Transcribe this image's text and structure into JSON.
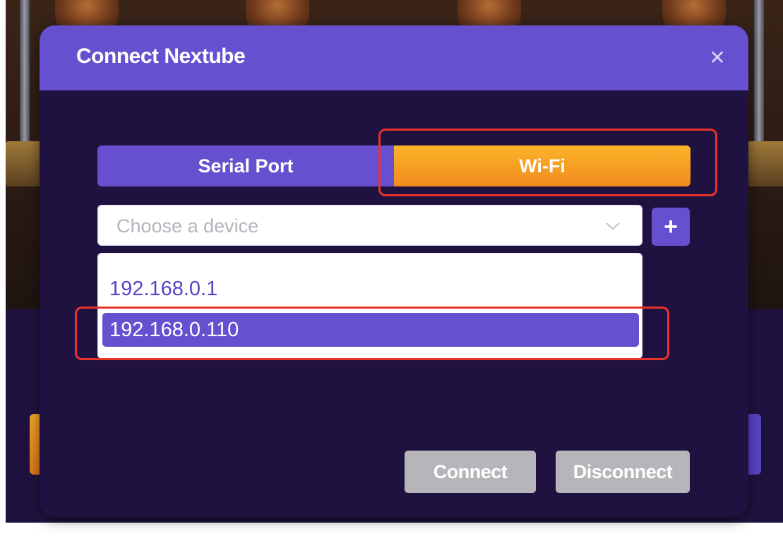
{
  "dialog": {
    "title": "Connect Nextube",
    "close_icon": "close-icon"
  },
  "tabs": [
    {
      "label": "Serial Port",
      "active": false
    },
    {
      "label": "Wi-Fi",
      "active": true
    }
  ],
  "device_select": {
    "placeholder": "Choose a device",
    "icon": "chevron-down-icon"
  },
  "add_button": {
    "label": "+",
    "icon": "plus-icon"
  },
  "device_options": [
    {
      "label": "192.168.0.1",
      "selected": false
    },
    {
      "label": "192.168.0.110",
      "selected": true
    }
  ],
  "actions": {
    "connect_label": "Connect",
    "disconnect_label": "Disconnect"
  },
  "colors": {
    "accent": "#6650cf",
    "active_tab": "#f39a22",
    "background": "#1f1240",
    "highlight": "#e8332b",
    "disabled_button": "#b6b6ba"
  }
}
